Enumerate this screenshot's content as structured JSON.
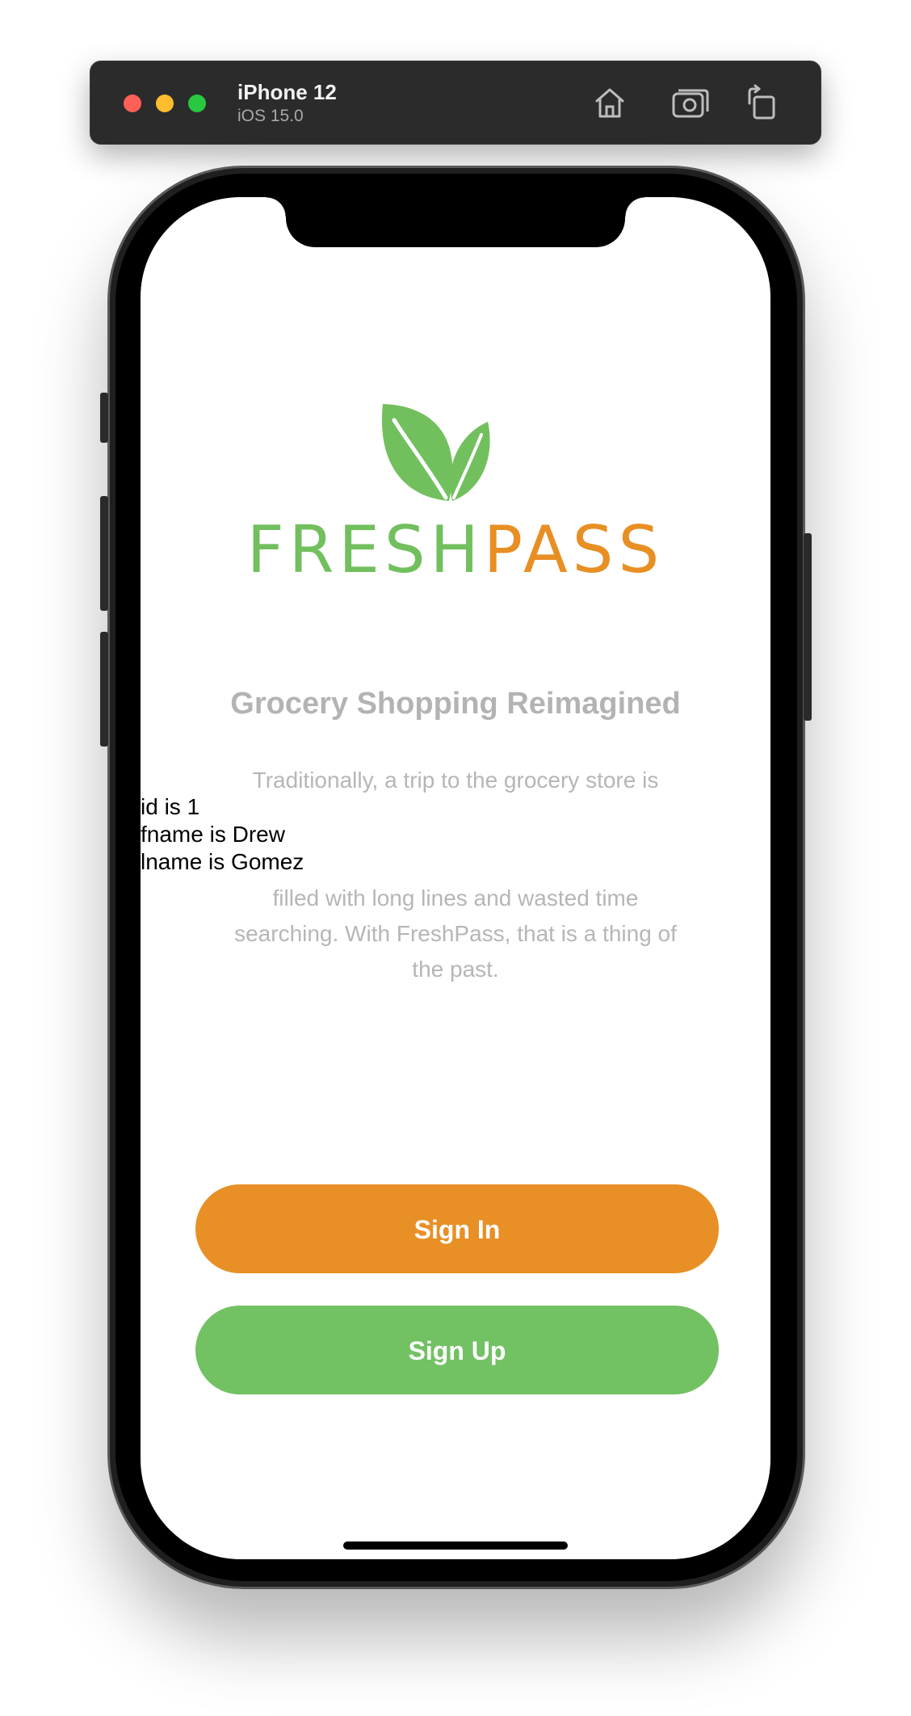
{
  "simulator": {
    "device_name": "iPhone 12",
    "os_version": "iOS 15.0",
    "icons": [
      "home-icon",
      "screenshot-icon",
      "rotate-icon"
    ]
  },
  "app": {
    "logo": {
      "part1": "FRESH",
      "part2": "PASS",
      "icon": "leaf-icon"
    },
    "headline": "Grocery Shopping Reimagined",
    "paragraph_line1": "Traditionally, a trip to the grocery store is",
    "paragraph_rest": "filled with long lines and wasted time searching. With FreshPass, that is a thing of the past.",
    "debug_lines": [
      "id is 1",
      "fname is Drew",
      "lname is Gomez"
    ],
    "buttons": {
      "sign_in": "Sign In",
      "sign_up": "Sign Up"
    }
  },
  "colors": {
    "green": "#72bf5e",
    "orange": "#e88f24",
    "text_gray": "#b3b3b3"
  }
}
